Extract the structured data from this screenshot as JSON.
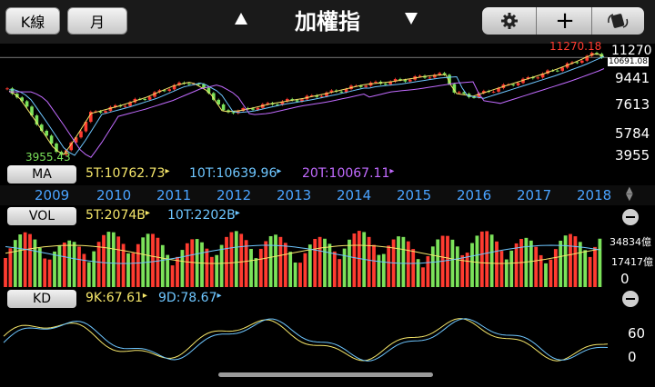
{
  "toolbar": {
    "chart_type_label": "K線",
    "period_label": "月",
    "title": "加權指",
    "settings_icon": "gear-icon",
    "add_icon": "plus-icon",
    "rotate_icon": "rotate-icon"
  },
  "price": {
    "high_label": "11270.18",
    "low_label": "3955.43",
    "current_label": "10691.08",
    "axis_ticks": [
      "11270",
      "9441",
      "7613",
      "5784",
      "3955"
    ]
  },
  "ma": {
    "tag": "MA",
    "ma5": "5T:10762.73",
    "ma10": "10T:10639.96",
    "ma20": "20T:10067.11"
  },
  "years": [
    "2009",
    "2010",
    "2011",
    "2012",
    "2013",
    "2014",
    "2015",
    "2016",
    "2017",
    "2018"
  ],
  "vol": {
    "tag": "VOL",
    "v5": "5T:2074B",
    "v10": "10T:2202B",
    "axis_ticks": [
      "34834億",
      "17417億",
      "0"
    ]
  },
  "kd": {
    "tag": "KD",
    "k": "9K:67.61",
    "d": "9D:78.67",
    "axis_ticks": [
      "60",
      "0"
    ]
  },
  "colors": {
    "up": "#ff3b30",
    "down": "#7be25a",
    "ma5": "#f5e66a",
    "ma10": "#6ec6ff",
    "ma20": "#c26bff",
    "year": "#4aa3ff"
  },
  "chart_data": {
    "type": "candlestick",
    "title": "加權指",
    "x_range": [
      "2009",
      "2018"
    ],
    "ylim": [
      3955.43,
      11270.18
    ],
    "high": 11270.18,
    "low": 3955.43,
    "last": 10691.08,
    "ma": {
      "5T": 10762.73,
      "10T": 10639.96,
      "20T": 10067.11
    },
    "volume_ticks": [
      34834,
      17417,
      0
    ],
    "kd": {
      "K": 67.61,
      "D": 78.67
    }
  }
}
